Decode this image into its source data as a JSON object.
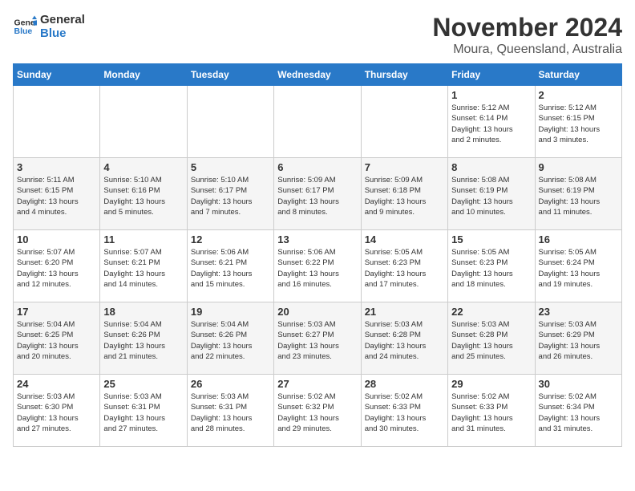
{
  "logo": {
    "line1": "General",
    "line2": "Blue"
  },
  "title": "November 2024",
  "location": "Moura, Queensland, Australia",
  "weekdays": [
    "Sunday",
    "Monday",
    "Tuesday",
    "Wednesday",
    "Thursday",
    "Friday",
    "Saturday"
  ],
  "weeks": [
    [
      {
        "day": "",
        "info": ""
      },
      {
        "day": "",
        "info": ""
      },
      {
        "day": "",
        "info": ""
      },
      {
        "day": "",
        "info": ""
      },
      {
        "day": "",
        "info": ""
      },
      {
        "day": "1",
        "info": "Sunrise: 5:12 AM\nSunset: 6:14 PM\nDaylight: 13 hours\nand 2 minutes."
      },
      {
        "day": "2",
        "info": "Sunrise: 5:12 AM\nSunset: 6:15 PM\nDaylight: 13 hours\nand 3 minutes."
      }
    ],
    [
      {
        "day": "3",
        "info": "Sunrise: 5:11 AM\nSunset: 6:15 PM\nDaylight: 13 hours\nand 4 minutes."
      },
      {
        "day": "4",
        "info": "Sunrise: 5:10 AM\nSunset: 6:16 PM\nDaylight: 13 hours\nand 5 minutes."
      },
      {
        "day": "5",
        "info": "Sunrise: 5:10 AM\nSunset: 6:17 PM\nDaylight: 13 hours\nand 7 minutes."
      },
      {
        "day": "6",
        "info": "Sunrise: 5:09 AM\nSunset: 6:17 PM\nDaylight: 13 hours\nand 8 minutes."
      },
      {
        "day": "7",
        "info": "Sunrise: 5:09 AM\nSunset: 6:18 PM\nDaylight: 13 hours\nand 9 minutes."
      },
      {
        "day": "8",
        "info": "Sunrise: 5:08 AM\nSunset: 6:19 PM\nDaylight: 13 hours\nand 10 minutes."
      },
      {
        "day": "9",
        "info": "Sunrise: 5:08 AM\nSunset: 6:19 PM\nDaylight: 13 hours\nand 11 minutes."
      }
    ],
    [
      {
        "day": "10",
        "info": "Sunrise: 5:07 AM\nSunset: 6:20 PM\nDaylight: 13 hours\nand 12 minutes."
      },
      {
        "day": "11",
        "info": "Sunrise: 5:07 AM\nSunset: 6:21 PM\nDaylight: 13 hours\nand 14 minutes."
      },
      {
        "day": "12",
        "info": "Sunrise: 5:06 AM\nSunset: 6:21 PM\nDaylight: 13 hours\nand 15 minutes."
      },
      {
        "day": "13",
        "info": "Sunrise: 5:06 AM\nSunset: 6:22 PM\nDaylight: 13 hours\nand 16 minutes."
      },
      {
        "day": "14",
        "info": "Sunrise: 5:05 AM\nSunset: 6:23 PM\nDaylight: 13 hours\nand 17 minutes."
      },
      {
        "day": "15",
        "info": "Sunrise: 5:05 AM\nSunset: 6:23 PM\nDaylight: 13 hours\nand 18 minutes."
      },
      {
        "day": "16",
        "info": "Sunrise: 5:05 AM\nSunset: 6:24 PM\nDaylight: 13 hours\nand 19 minutes."
      }
    ],
    [
      {
        "day": "17",
        "info": "Sunrise: 5:04 AM\nSunset: 6:25 PM\nDaylight: 13 hours\nand 20 minutes."
      },
      {
        "day": "18",
        "info": "Sunrise: 5:04 AM\nSunset: 6:26 PM\nDaylight: 13 hours\nand 21 minutes."
      },
      {
        "day": "19",
        "info": "Sunrise: 5:04 AM\nSunset: 6:26 PM\nDaylight: 13 hours\nand 22 minutes."
      },
      {
        "day": "20",
        "info": "Sunrise: 5:03 AM\nSunset: 6:27 PM\nDaylight: 13 hours\nand 23 minutes."
      },
      {
        "day": "21",
        "info": "Sunrise: 5:03 AM\nSunset: 6:28 PM\nDaylight: 13 hours\nand 24 minutes."
      },
      {
        "day": "22",
        "info": "Sunrise: 5:03 AM\nSunset: 6:28 PM\nDaylight: 13 hours\nand 25 minutes."
      },
      {
        "day": "23",
        "info": "Sunrise: 5:03 AM\nSunset: 6:29 PM\nDaylight: 13 hours\nand 26 minutes."
      }
    ],
    [
      {
        "day": "24",
        "info": "Sunrise: 5:03 AM\nSunset: 6:30 PM\nDaylight: 13 hours\nand 27 minutes."
      },
      {
        "day": "25",
        "info": "Sunrise: 5:03 AM\nSunset: 6:31 PM\nDaylight: 13 hours\nand 27 minutes."
      },
      {
        "day": "26",
        "info": "Sunrise: 5:03 AM\nSunset: 6:31 PM\nDaylight: 13 hours\nand 28 minutes."
      },
      {
        "day": "27",
        "info": "Sunrise: 5:02 AM\nSunset: 6:32 PM\nDaylight: 13 hours\nand 29 minutes."
      },
      {
        "day": "28",
        "info": "Sunrise: 5:02 AM\nSunset: 6:33 PM\nDaylight: 13 hours\nand 30 minutes."
      },
      {
        "day": "29",
        "info": "Sunrise: 5:02 AM\nSunset: 6:33 PM\nDaylight: 13 hours\nand 31 minutes."
      },
      {
        "day": "30",
        "info": "Sunrise: 5:02 AM\nSunset: 6:34 PM\nDaylight: 13 hours\nand 31 minutes."
      }
    ]
  ]
}
